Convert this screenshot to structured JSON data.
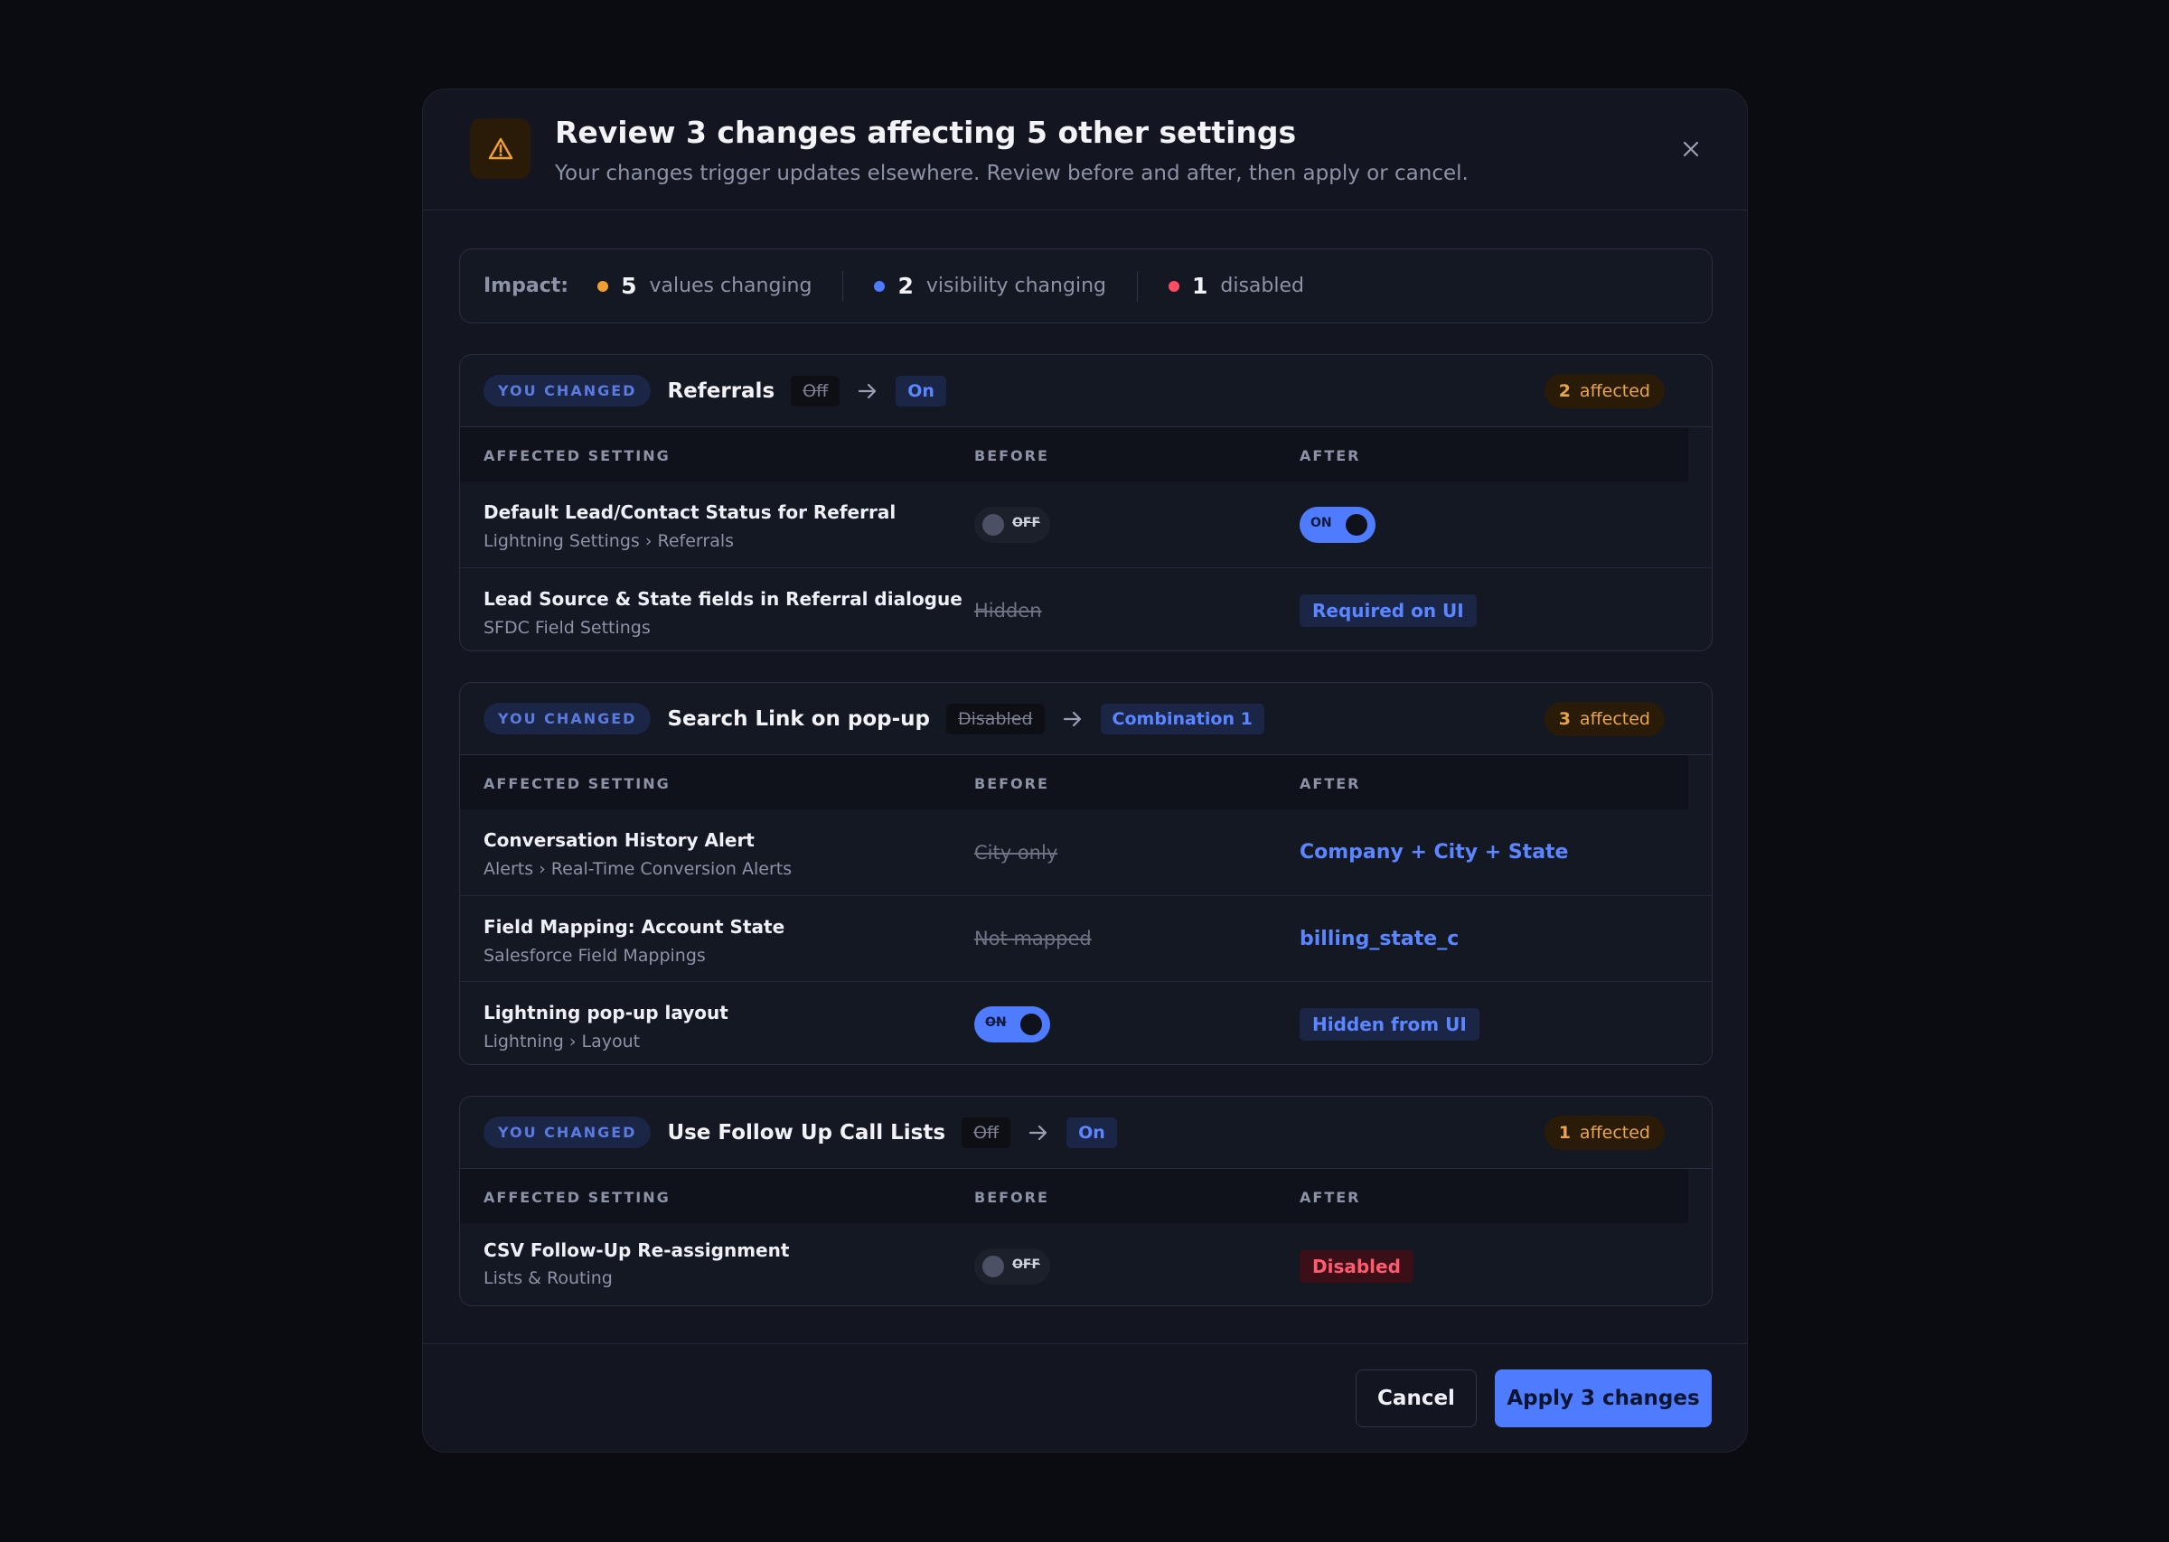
{
  "header": {
    "title": "Review 3 changes affecting 5 other settings",
    "subtitle": "Your changes trigger updates elsewhere. Review before and after, then apply or cancel.",
    "icon": "warning-triangle-icon",
    "close_icon": "close-icon"
  },
  "impact": {
    "label": "Impact:",
    "items": [
      {
        "count": "5",
        "text": "values changing",
        "color": "#f0a030"
      },
      {
        "count": "2",
        "text": "visibility changing",
        "color": "#4f7cff"
      },
      {
        "count": "1",
        "text": "disabled",
        "color": "#ff4d63"
      }
    ]
  },
  "table_headers": {
    "setting": "AFFECTED SETTING",
    "before": "BEFORE",
    "after": "AFTER"
  },
  "groups": [
    {
      "tag": "YOU CHANGED",
      "name": "Referrals",
      "from": "Off",
      "to": "On",
      "affected_count": "2",
      "affected_label": "affected",
      "rows": [
        {
          "name": "Default Lead/Contact Status for Referral",
          "path": "Lightning Settings › Referrals",
          "before": "OFF",
          "after": "ON"
        },
        {
          "name": "Lead Source & State fields in Referral dialogue",
          "path": "SFDC Field Settings",
          "before": "Hidden",
          "after": "Required on UI"
        }
      ]
    },
    {
      "tag": "YOU CHANGED",
      "name": "Search Link on pop-up",
      "from": "Disabled",
      "to": "Combination 1",
      "affected_count": "3",
      "affected_label": "affected",
      "rows": [
        {
          "name": "Conversation History Alert",
          "path": "Alerts › Real-Time Conversion Alerts",
          "before": "City only",
          "after": "Company + City + State"
        },
        {
          "name": "Field Mapping: Account State",
          "path": "Salesforce Field Mappings",
          "before": "Not mapped",
          "after": "billing_state_c"
        },
        {
          "name": "Lightning pop-up layout",
          "path": "Lightning › Layout",
          "before": "ON",
          "after": "Hidden from UI"
        }
      ]
    },
    {
      "tag": "YOU CHANGED",
      "name": "Use Follow Up Call Lists",
      "from": "Off",
      "to": "On",
      "affected_count": "1",
      "affected_label": "affected",
      "rows": [
        {
          "name": "CSV Follow-Up Re-assignment",
          "path": "Lists & Routing",
          "before": "OFF",
          "after": "Disabled"
        }
      ]
    }
  ],
  "footer": {
    "cancel_label": "Cancel",
    "apply_label": "Apply 3 changes"
  }
}
